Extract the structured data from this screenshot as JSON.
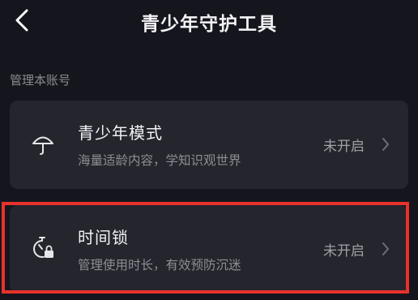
{
  "header": {
    "title": "青少年守护工具",
    "back_icon": "chevron-left-icon"
  },
  "section": {
    "label": "管理本账号"
  },
  "items": [
    {
      "title": "青少年模式",
      "subtitle": "海量适龄内容，学知识观世界",
      "status": "未开启",
      "icon": "umbrella-icon"
    },
    {
      "title": "时间锁",
      "subtitle": "管理使用时长，有效预防沉迷",
      "status": "未开启",
      "icon": "timer-lock-icon"
    }
  ],
  "colors": {
    "background": "#15161d",
    "card": "#24252d",
    "highlight": "#e8322c"
  }
}
